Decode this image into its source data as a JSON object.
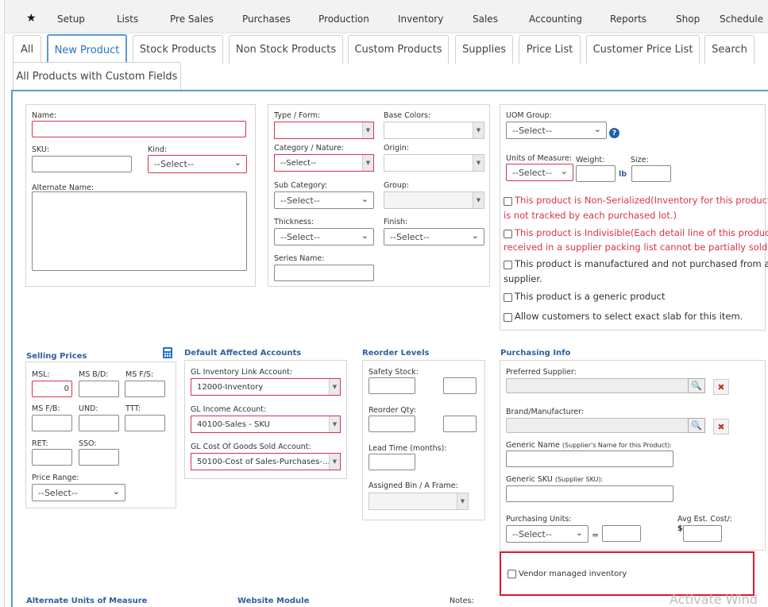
{
  "menu": {
    "items": [
      "Setup",
      "Lists",
      "Pre Sales",
      "Purchases",
      "Production",
      "Inventory",
      "Sales",
      "Accounting",
      "Reports",
      "Shop",
      "Schedule"
    ]
  },
  "tabs": [
    "All",
    "New Product",
    "Stock Products",
    "Non Stock Products",
    "Custom Products",
    "Supplies",
    "Price List",
    "Customer Price List",
    "Search",
    "All Products with Custom Fields"
  ],
  "active_tab": "New Product",
  "general": {
    "name_label": "Name:",
    "sku_label": "SKU:",
    "kind_label": "Kind:",
    "kind_value": "--Select--",
    "alt_name_label": "Alternate Name:"
  },
  "classification": {
    "type_form_label": "Type / Form:",
    "base_colors_label": "Base Colors:",
    "category_label": "Category / Nature:",
    "category_value": "--Select--",
    "origin_label": "Origin:",
    "subcat_label": "Sub Category:",
    "subcat_value": "--Select--",
    "group_label": "Group:",
    "thickness_label": "Thickness:",
    "thickness_value": "--Select--",
    "finish_label": "Finish:",
    "finish_value": "--Select--",
    "series_label": "Series Name:"
  },
  "uom": {
    "group_label": "UOM Group:",
    "group_value": "--Select--",
    "units_label": "Units of Measure:",
    "units_value": "--Select--",
    "weight_label": "Weight:",
    "weight_unit": "lb",
    "size_label": "Size:",
    "checks": [
      {
        "text1": "This product is Non-Serialized(Inventory for this product",
        "text2": "is not tracked by each purchased lot.)",
        "red": true
      },
      {
        "text1": "This product is Indivisible(Each detail line of this product",
        "text2": "received in a supplier packing list cannot be partially sold)",
        "red": true
      },
      {
        "text1": "This product is manufactured and not purchased from a",
        "text2": "supplier.",
        "red": false
      },
      {
        "text1": "This product is a generic product",
        "text2": "",
        "red": false
      },
      {
        "text1": "Allow customers to select exact slab for this item.",
        "text2": "",
        "red": false
      }
    ]
  },
  "selling": {
    "title": "Selling Prices",
    "msl_label": "MSL:",
    "msl_value": "0",
    "msbd_label": "MS B/D:",
    "msfs_label": "MS F/S:",
    "msfb_label": "MS F/B:",
    "und_label": "UND:",
    "ttt_label": "TTT:",
    "ret_label": "RET:",
    "sso_label": "SSO:",
    "price_range_label": "Price Range:",
    "price_range_value": "--Select--"
  },
  "accounts": {
    "title": "Default Affected Accounts",
    "inv_label": "GL Inventory Link Account:",
    "inv_value": "12000-Inventory",
    "income_label": "GL Income Account:",
    "income_value": "40100-Sales - SKU",
    "cogs_label": "GL Cost Of Goods Sold Account:",
    "cogs_value": "50100-Cost of Sales-Purchases-..."
  },
  "reorder": {
    "title": "Reorder Levels",
    "safety_label": "Safety Stock:",
    "qty_label": "Reorder Qty:",
    "lead_label": "Lead Time (months):",
    "bin_label": "Assigned Bin / A Frame:"
  },
  "purchasing": {
    "title": "Purchasing Info",
    "supplier_label": "Preferred Supplier:",
    "brand_label": "Brand/Manufacturer:",
    "generic_name_label": "Generic Name",
    "generic_name_hint": "(Supplier's Name for this Product):",
    "generic_sku_label": "Generic SKU",
    "generic_sku_hint": "(Supplier SKU):",
    "units_label": "Purchasing Units:",
    "units_value": "--Select--",
    "equals": "=",
    "avg_cost_label": "Avg Est. Cost/:",
    "currency": "$",
    "vendor_managed_label": "Vendor managed inventory"
  },
  "bottom": {
    "alt_units_title": "Alternate Units of Measure",
    "website_title": "Website Module",
    "notes_label": "Notes:"
  },
  "watermark": "Activate Wind",
  "colors": {
    "accent": "#2b70c6",
    "required": "#d9334a",
    "highlight": "#e0182f"
  }
}
